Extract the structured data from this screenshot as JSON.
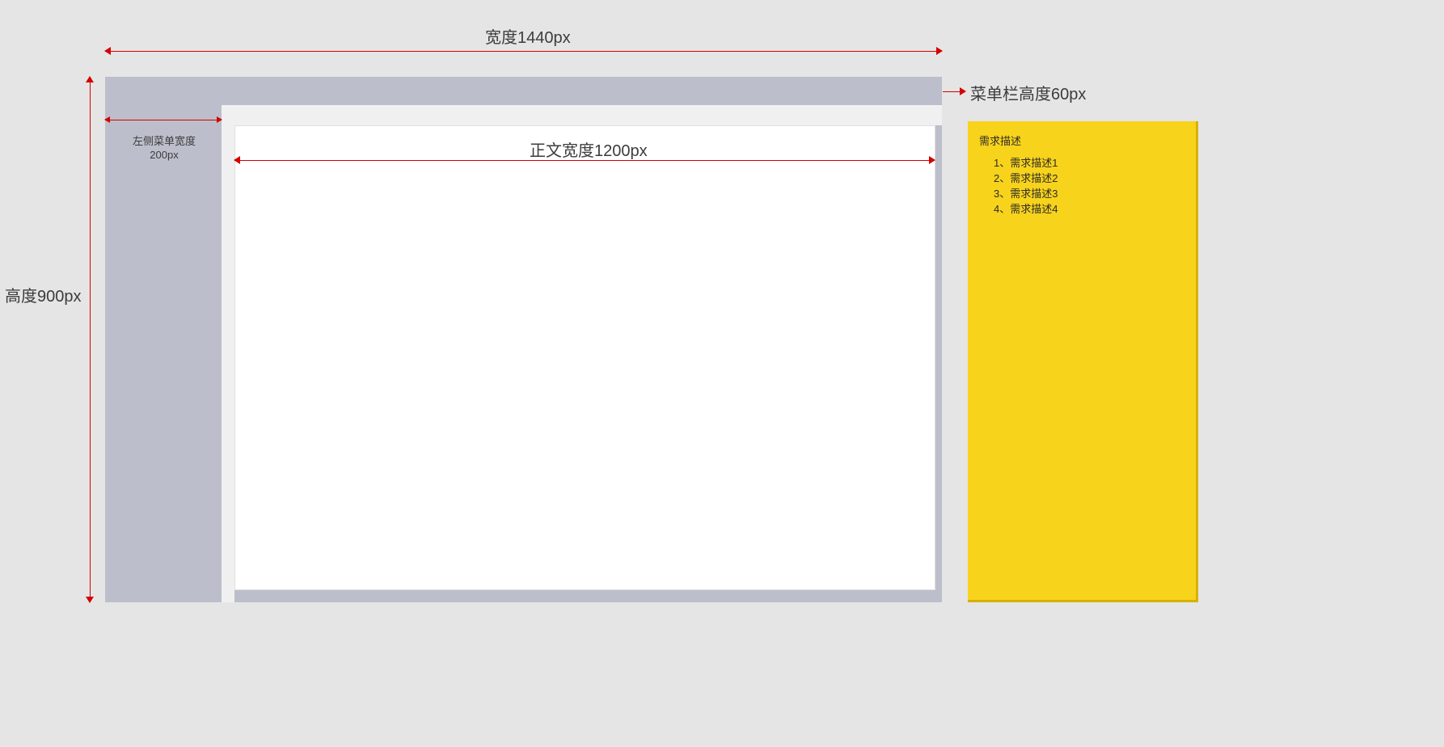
{
  "dimensions": {
    "total_width_label": "宽度1440px",
    "total_height_label": "高度900px",
    "sidebar_width_label_line1": "左侧菜单宽度",
    "sidebar_width_label_line2": "200px",
    "content_width_label": "正文宽度1200px",
    "menu_height_label": "菜单栏高度60px"
  },
  "requirements": {
    "title": "需求描述",
    "items": [
      "1、需求描述1",
      "2、需求描述2",
      "3、需求描述3",
      "4、需求描述4"
    ]
  },
  "colors": {
    "page_bg": "#e5e5e5",
    "frame_bg": "#bcbfcb",
    "content_bg": "#ffffff",
    "gap_bg": "#f0f0f0",
    "dim_line": "#d40000",
    "req_panel_bg": "#f8d31c"
  }
}
